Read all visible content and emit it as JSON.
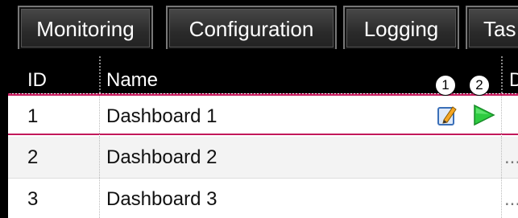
{
  "tabs": [
    {
      "label": "Monitoring"
    },
    {
      "label": "Configuration"
    },
    {
      "label": "Logging"
    },
    {
      "label": "Tas"
    }
  ],
  "table": {
    "columns": [
      "ID",
      "Name",
      "D"
    ],
    "rows": [
      {
        "id": "1",
        "name": "Dashboard 1",
        "extra": ""
      },
      {
        "id": "2",
        "name": "Dashboard 2",
        "extra": "..."
      },
      {
        "id": "3",
        "name": "Dashboard 3",
        "extra": "..."
      }
    ]
  },
  "row_actions": {
    "edit_icon": "edit-pencil-icon",
    "run_icon": "play-icon"
  },
  "callouts": [
    "1",
    "2"
  ],
  "colors": {
    "selection_border": "#c2185b",
    "play_green": "#2ecc40",
    "header_bg": "#000000"
  }
}
